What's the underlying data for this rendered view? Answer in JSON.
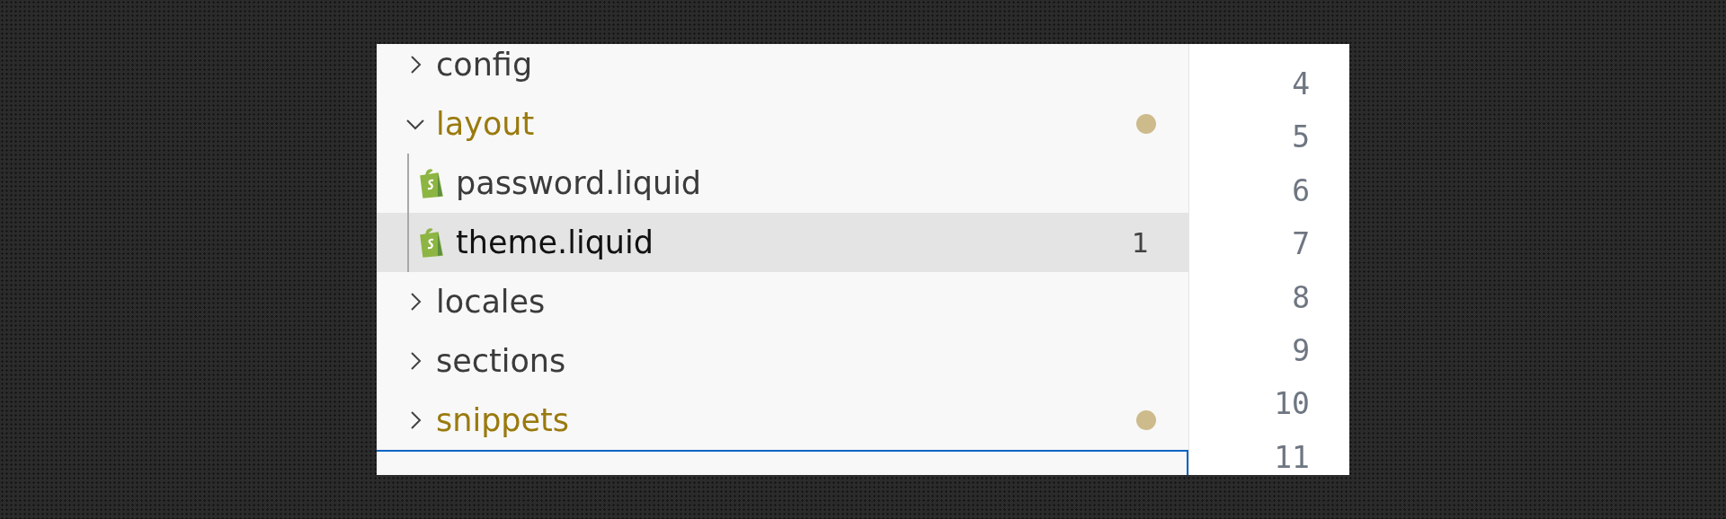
{
  "explorer": {
    "items": [
      {
        "kind": "folder",
        "label": "config",
        "expanded": false,
        "modified": false
      },
      {
        "kind": "folder",
        "label": "layout",
        "expanded": true,
        "modified": true,
        "children": [
          {
            "kind": "file",
            "label": "password.liquid",
            "selected": false
          },
          {
            "kind": "file",
            "label": "theme.liquid",
            "selected": true,
            "badge": "1"
          }
        ]
      },
      {
        "kind": "folder",
        "label": "locales",
        "expanded": false,
        "modified": false
      },
      {
        "kind": "folder",
        "label": "sections",
        "expanded": false,
        "modified": false
      },
      {
        "kind": "folder",
        "label": "snippets",
        "expanded": false,
        "modified": true
      }
    ]
  },
  "editor": {
    "line_numbers": [
      "4",
      "5",
      "6",
      "7",
      "8",
      "9",
      "10",
      "11"
    ]
  }
}
